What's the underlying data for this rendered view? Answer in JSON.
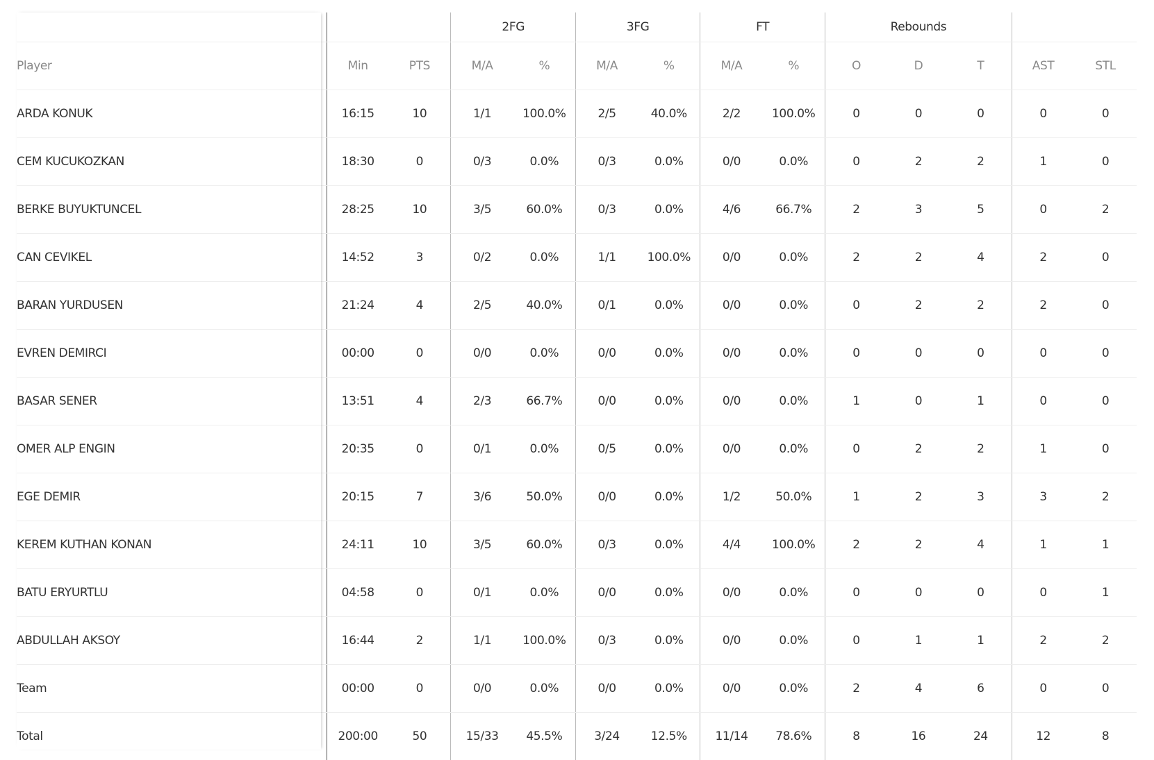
{
  "groups": {
    "fg2": "2FG",
    "fg3": "3FG",
    "ft": "FT",
    "rebounds": "Rebounds"
  },
  "columns": {
    "player": "Player",
    "min": "Min",
    "pts": "PTS",
    "fg2_ma": "M/A",
    "fg2_pct": "%",
    "fg3_ma": "M/A",
    "fg3_pct": "%",
    "ft_ma": "M/A",
    "ft_pct": "%",
    "reb_o": "O",
    "reb_d": "D",
    "reb_t": "T",
    "ast": "AST",
    "stl": "STL"
  },
  "rows": [
    {
      "name": "ARDA KONUK",
      "min": "16:15",
      "pts": "10",
      "fg2_ma": "1/1",
      "fg2_pct": "100.0%",
      "fg3_ma": "2/5",
      "fg3_pct": "40.0%",
      "ft_ma": "2/2",
      "ft_pct": "100.0%",
      "reb_o": "0",
      "reb_d": "0",
      "reb_t": "0",
      "ast": "0",
      "stl": "0"
    },
    {
      "name": "CEM KUCUKOZKAN",
      "min": "18:30",
      "pts": "0",
      "fg2_ma": "0/3",
      "fg2_pct": "0.0%",
      "fg3_ma": "0/3",
      "fg3_pct": "0.0%",
      "ft_ma": "0/0",
      "ft_pct": "0.0%",
      "reb_o": "0",
      "reb_d": "2",
      "reb_t": "2",
      "ast": "1",
      "stl": "0"
    },
    {
      "name": "BERKE BUYUKTUNCEL",
      "min": "28:25",
      "pts": "10",
      "fg2_ma": "3/5",
      "fg2_pct": "60.0%",
      "fg3_ma": "0/3",
      "fg3_pct": "0.0%",
      "ft_ma": "4/6",
      "ft_pct": "66.7%",
      "reb_o": "2",
      "reb_d": "3",
      "reb_t": "5",
      "ast": "0",
      "stl": "2"
    },
    {
      "name": "CAN CEVIKEL",
      "min": "14:52",
      "pts": "3",
      "fg2_ma": "0/2",
      "fg2_pct": "0.0%",
      "fg3_ma": "1/1",
      "fg3_pct": "100.0%",
      "ft_ma": "0/0",
      "ft_pct": "0.0%",
      "reb_o": "2",
      "reb_d": "2",
      "reb_t": "4",
      "ast": "2",
      "stl": "0"
    },
    {
      "name": "BARAN YURDUSEN",
      "min": "21:24",
      "pts": "4",
      "fg2_ma": "2/5",
      "fg2_pct": "40.0%",
      "fg3_ma": "0/1",
      "fg3_pct": "0.0%",
      "ft_ma": "0/0",
      "ft_pct": "0.0%",
      "reb_o": "0",
      "reb_d": "2",
      "reb_t": "2",
      "ast": "2",
      "stl": "0"
    },
    {
      "name": "EVREN DEMIRCI",
      "min": "00:00",
      "pts": "0",
      "fg2_ma": "0/0",
      "fg2_pct": "0.0%",
      "fg3_ma": "0/0",
      "fg3_pct": "0.0%",
      "ft_ma": "0/0",
      "ft_pct": "0.0%",
      "reb_o": "0",
      "reb_d": "0",
      "reb_t": "0",
      "ast": "0",
      "stl": "0"
    },
    {
      "name": "BASAR SENER",
      "min": "13:51",
      "pts": "4",
      "fg2_ma": "2/3",
      "fg2_pct": "66.7%",
      "fg3_ma": "0/0",
      "fg3_pct": "0.0%",
      "ft_ma": "0/0",
      "ft_pct": "0.0%",
      "reb_o": "1",
      "reb_d": "0",
      "reb_t": "1",
      "ast": "0",
      "stl": "0"
    },
    {
      "name": "OMER ALP ENGIN",
      "min": "20:35",
      "pts": "0",
      "fg2_ma": "0/1",
      "fg2_pct": "0.0%",
      "fg3_ma": "0/5",
      "fg3_pct": "0.0%",
      "ft_ma": "0/0",
      "ft_pct": "0.0%",
      "reb_o": "0",
      "reb_d": "2",
      "reb_t": "2",
      "ast": "1",
      "stl": "0"
    },
    {
      "name": "EGE DEMIR",
      "min": "20:15",
      "pts": "7",
      "fg2_ma": "3/6",
      "fg2_pct": "50.0%",
      "fg3_ma": "0/0",
      "fg3_pct": "0.0%",
      "ft_ma": "1/2",
      "ft_pct": "50.0%",
      "reb_o": "1",
      "reb_d": "2",
      "reb_t": "3",
      "ast": "3",
      "stl": "2"
    },
    {
      "name": "KEREM KUTHAN KONAN",
      "min": "24:11",
      "pts": "10",
      "fg2_ma": "3/5",
      "fg2_pct": "60.0%",
      "fg3_ma": "0/3",
      "fg3_pct": "0.0%",
      "ft_ma": "4/4",
      "ft_pct": "100.0%",
      "reb_o": "2",
      "reb_d": "2",
      "reb_t": "4",
      "ast": "1",
      "stl": "1"
    },
    {
      "name": "BATU ERYURTLU",
      "min": "04:58",
      "pts": "0",
      "fg2_ma": "0/1",
      "fg2_pct": "0.0%",
      "fg3_ma": "0/0",
      "fg3_pct": "0.0%",
      "ft_ma": "0/0",
      "ft_pct": "0.0%",
      "reb_o": "0",
      "reb_d": "0",
      "reb_t": "0",
      "ast": "0",
      "stl": "1"
    },
    {
      "name": "ABDULLAH AKSOY",
      "min": "16:44",
      "pts": "2",
      "fg2_ma": "1/1",
      "fg2_pct": "100.0%",
      "fg3_ma": "0/3",
      "fg3_pct": "0.0%",
      "ft_ma": "0/0",
      "ft_pct": "0.0%",
      "reb_o": "0",
      "reb_d": "1",
      "reb_t": "1",
      "ast": "2",
      "stl": "2"
    },
    {
      "name": "Team",
      "min": "00:00",
      "pts": "0",
      "fg2_ma": "0/0",
      "fg2_pct": "0.0%",
      "fg3_ma": "0/0",
      "fg3_pct": "0.0%",
      "ft_ma": "0/0",
      "ft_pct": "0.0%",
      "reb_o": "2",
      "reb_d": "4",
      "reb_t": "6",
      "ast": "0",
      "stl": "0"
    },
    {
      "name": "Total",
      "min": "200:00",
      "pts": "50",
      "fg2_ma": "15/33",
      "fg2_pct": "45.5%",
      "fg3_ma": "3/24",
      "fg3_pct": "12.5%",
      "ft_ma": "11/14",
      "ft_pct": "78.6%",
      "reb_o": "8",
      "reb_d": "16",
      "reb_t": "24",
      "ast": "12",
      "stl": "8"
    }
  ]
}
